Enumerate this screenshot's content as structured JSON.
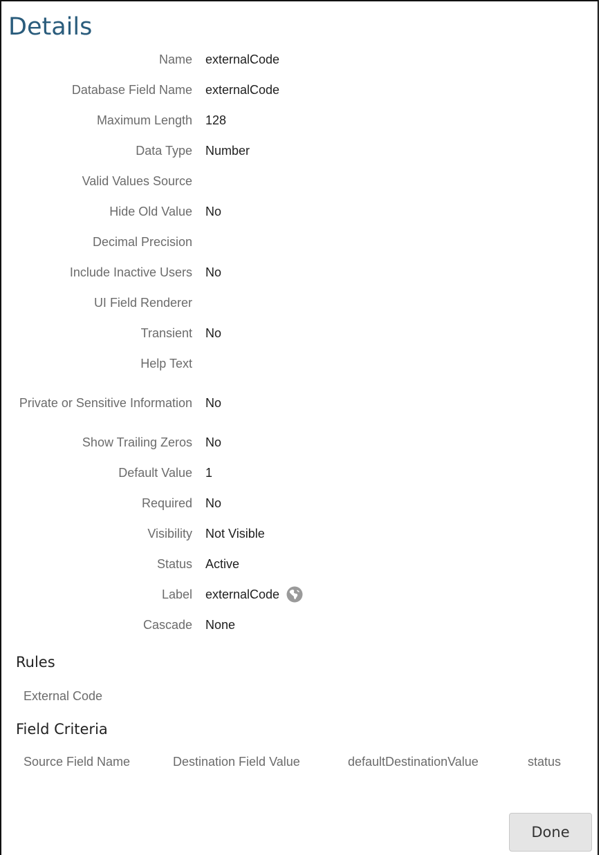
{
  "title": "Details",
  "fields": [
    {
      "label": "Name",
      "value": "externalCode"
    },
    {
      "label": "Database Field Name",
      "value": "externalCode"
    },
    {
      "label": "Maximum Length",
      "value": "128"
    },
    {
      "label": "Data Type",
      "value": "Number"
    },
    {
      "label": "Valid Values Source",
      "value": ""
    },
    {
      "label": "Hide Old Value",
      "value": "No"
    },
    {
      "label": "Decimal Precision",
      "value": ""
    },
    {
      "label": "Include Inactive Users",
      "value": "No"
    },
    {
      "label": "UI Field Renderer",
      "value": ""
    },
    {
      "label": "Transient",
      "value": "No"
    },
    {
      "label": "Help Text",
      "value": ""
    },
    {
      "label": "Private or Sensitive Information",
      "value": "No"
    },
    {
      "label": "Show Trailing Zeros",
      "value": "No"
    },
    {
      "label": "Default Value",
      "value": "1"
    },
    {
      "label": "Required",
      "value": "No"
    },
    {
      "label": "Visibility",
      "value": "Not Visible"
    },
    {
      "label": "Status",
      "value": "Active"
    },
    {
      "label": "Label",
      "value": "externalCode",
      "icon": "globe-icon"
    },
    {
      "label": "Cascade",
      "value": "None"
    }
  ],
  "rules": {
    "heading": "Rules",
    "items": [
      "External Code"
    ]
  },
  "field_criteria": {
    "heading": "Field Criteria",
    "columns": [
      "Source Field Name",
      "Destination Field Value",
      "defaultDestinationValue",
      "status"
    ]
  },
  "done_button": {
    "label": "Done"
  },
  "colors": {
    "title": "#2a5c7c",
    "label_text": "#6b6b6b",
    "value_text": "#1e1e1e",
    "button_bg": "#e5e5e5",
    "globe_icon": "#9a9a9a"
  }
}
